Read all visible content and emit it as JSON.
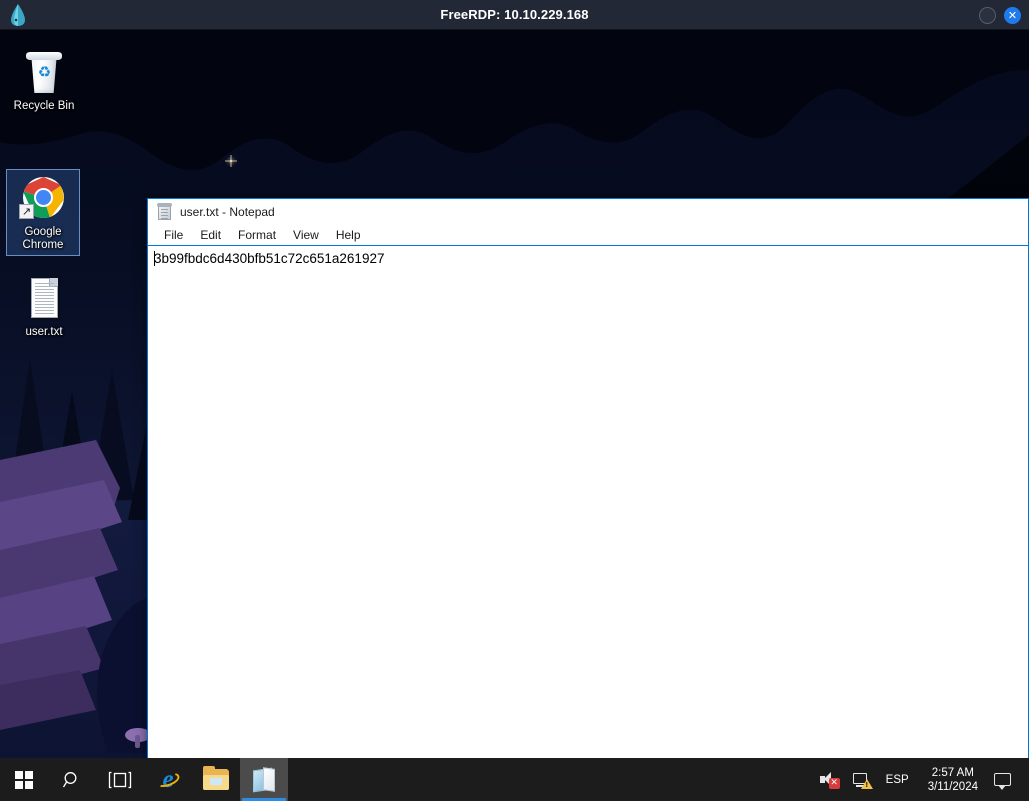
{
  "rdp_window": {
    "title": "FreeRDP: 10.10.229.168",
    "logo_icon": "freerdp-logo-icon",
    "controls": {
      "minimize_icon": "minimize-circle-icon",
      "close_icon": "close-circle-icon",
      "close_glyph": "✕"
    }
  },
  "desktop": {
    "icons": [
      {
        "label": "Recycle Bin",
        "icon": "recycle-bin-icon",
        "selected": false,
        "recycle_glyph": "♻"
      },
      {
        "label": "Google Chrome",
        "icon": "google-chrome-icon",
        "selected": true,
        "shortcut_glyph": "↗"
      },
      {
        "label": "user.txt",
        "icon": "text-file-icon",
        "selected": false
      }
    ]
  },
  "notepad": {
    "title": "user.txt - Notepad",
    "icon": "notepad-icon",
    "menus": [
      {
        "label": "File"
      },
      {
        "label": "Edit"
      },
      {
        "label": "Format"
      },
      {
        "label": "View"
      },
      {
        "label": "Help"
      }
    ],
    "content": "3b99fbdc6d430bfb51c72c651a261927"
  },
  "taskbar": {
    "start_icon": "windows-start-icon",
    "search_icon": "search-icon",
    "search_glyph": "⚲",
    "taskview_icon": "task-view-icon",
    "taskview_glyph": "[ ]",
    "apps": [
      {
        "name": "internet-explorer",
        "label": "e",
        "active": false
      },
      {
        "name": "file-explorer",
        "label": "",
        "active": false
      },
      {
        "name": "notepad",
        "label": "",
        "active": true
      }
    ],
    "tray": {
      "volume_icon": "volume-muted-icon",
      "volume_badge": "✕",
      "network_icon": "network-warning-icon",
      "language": "ESP",
      "clock_time": "2:57 AM",
      "clock_date": "3/11/2024",
      "action_center_icon": "action-center-icon",
      "show_desktop_icon": "show-desktop-button"
    }
  },
  "colors": {
    "titlebar_bg": "#232836",
    "accent_blue": "#0078d7",
    "close_blue": "#1e7bee",
    "taskbar_bg": "#1c1c1c"
  }
}
